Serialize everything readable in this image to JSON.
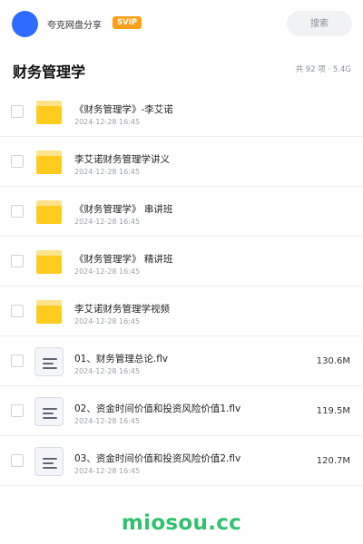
{
  "header": {
    "brand": "夸克网盘分享",
    "badge": "SVIP",
    "search_placeholder": "搜索"
  },
  "folder": {
    "title": "财务管理学",
    "stats": "共 92 项 · 5.4G"
  },
  "files": [
    {
      "type": "folder",
      "icon": "folder-icon",
      "name": "《财务管理学》-李艾诺",
      "date": "2024-12-28 16:45",
      "size": ""
    },
    {
      "type": "folder",
      "icon": "folder-icon",
      "name": "李艾诺财务管理学讲义",
      "date": "2024-12-28 16:45",
      "size": ""
    },
    {
      "type": "folder",
      "icon": "folder-icon",
      "name": "《财务管理学》 串讲班",
      "date": "2024-12-28 16:45",
      "size": ""
    },
    {
      "type": "folder",
      "icon": "folder-icon",
      "name": "《财务管理学》 精讲班",
      "date": "2024-12-28 16:45",
      "size": ""
    },
    {
      "type": "folder",
      "icon": "folder-icon",
      "name": "李艾诺财务管理学视频",
      "date": "2024-12-28 16:45",
      "size": ""
    },
    {
      "type": "file",
      "icon": "document-icon",
      "name": "01、财务管理总论.flv",
      "date": "2024-12-28 16:45",
      "size": "130.6M"
    },
    {
      "type": "file",
      "icon": "document-icon",
      "name": "02、资金时间价值和投资风险价值1.flv",
      "date": "2024-12-28 16:45",
      "size": "119.5M"
    },
    {
      "type": "file",
      "icon": "document-icon",
      "name": "03、资金时间价值和投资风险价值2.flv",
      "date": "2024-12-28 16:45",
      "size": "120.7M"
    }
  ],
  "watermark": "miosou.cc",
  "colors": {
    "accent": "#2f6bff",
    "badge": "#ff9f1a",
    "folder": "#ffcc1e",
    "watermark": "#31c06f"
  }
}
